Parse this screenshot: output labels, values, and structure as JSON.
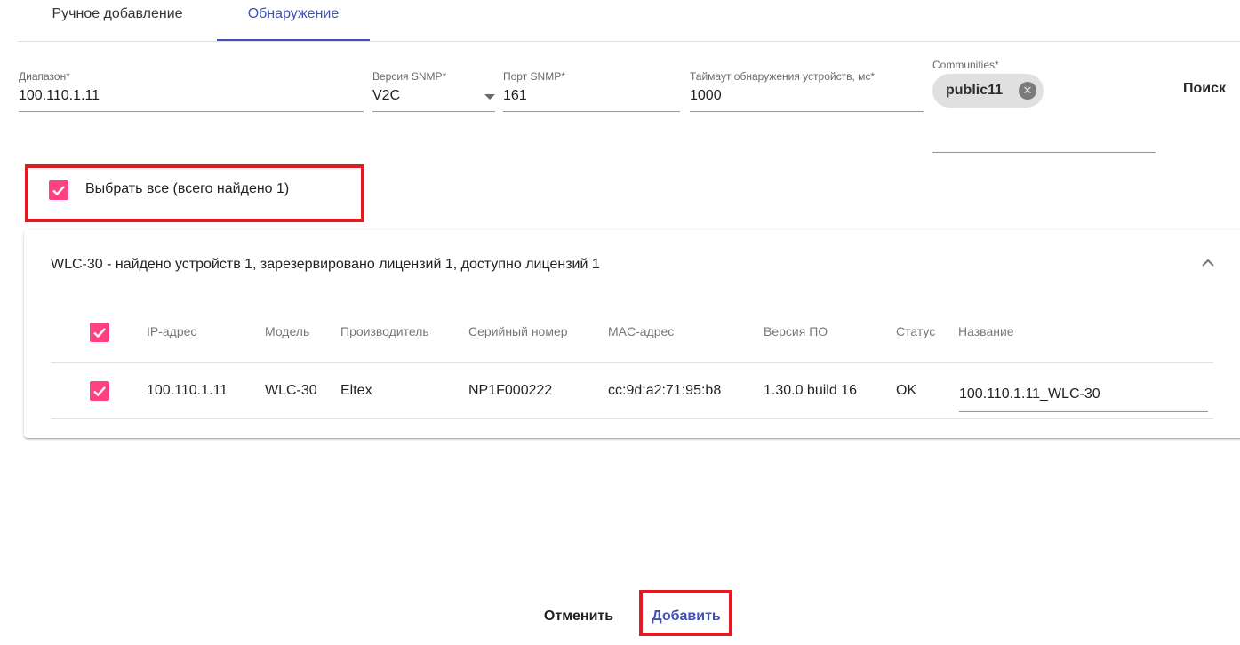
{
  "tabs": [
    {
      "label": "Ручное добавление",
      "active": false
    },
    {
      "label": "Обнаружение",
      "active": true
    }
  ],
  "form": {
    "range": {
      "label": "Диапазон*",
      "value": "100.110.1.11"
    },
    "snmp_version": {
      "label": "Версия SNMP*",
      "value": "V2C"
    },
    "snmp_port": {
      "label": "Порт SNMP*",
      "value": "161"
    },
    "timeout": {
      "label": "Таймаут обнаружения устройств, мс*",
      "value": "1000"
    },
    "communities": {
      "label": "Communities*",
      "chips": [
        "public11"
      ]
    },
    "search_label": "Поиск"
  },
  "select_all": {
    "label": "Выбрать все (всего найдено 1)",
    "checked": true
  },
  "group": {
    "title": "WLC-30 - найдено устройств 1, зарезервировано лицензий 1, доступно лицензий 1",
    "columns": [
      "IP-адрес",
      "Модель",
      "Производитель",
      "Серийный номер",
      "MAC-адрес",
      "Версия ПО",
      "Статус",
      "Название"
    ],
    "rows": [
      {
        "checked": true,
        "ip": "100.110.1.11",
        "model": "WLC-30",
        "vendor": "Eltex",
        "serial": "NP1F000222",
        "mac": "cc:9d:a2:71:95:b8",
        "firmware": "1.30.0 build 16",
        "status": "OK",
        "name": "100.110.1.11_WLC-30"
      }
    ]
  },
  "actions": {
    "cancel": "Отменить",
    "add": "Добавить"
  },
  "colors": {
    "accent": "#3f51b5",
    "checkbox": "#ff4081",
    "highlight": "#e01b24"
  }
}
